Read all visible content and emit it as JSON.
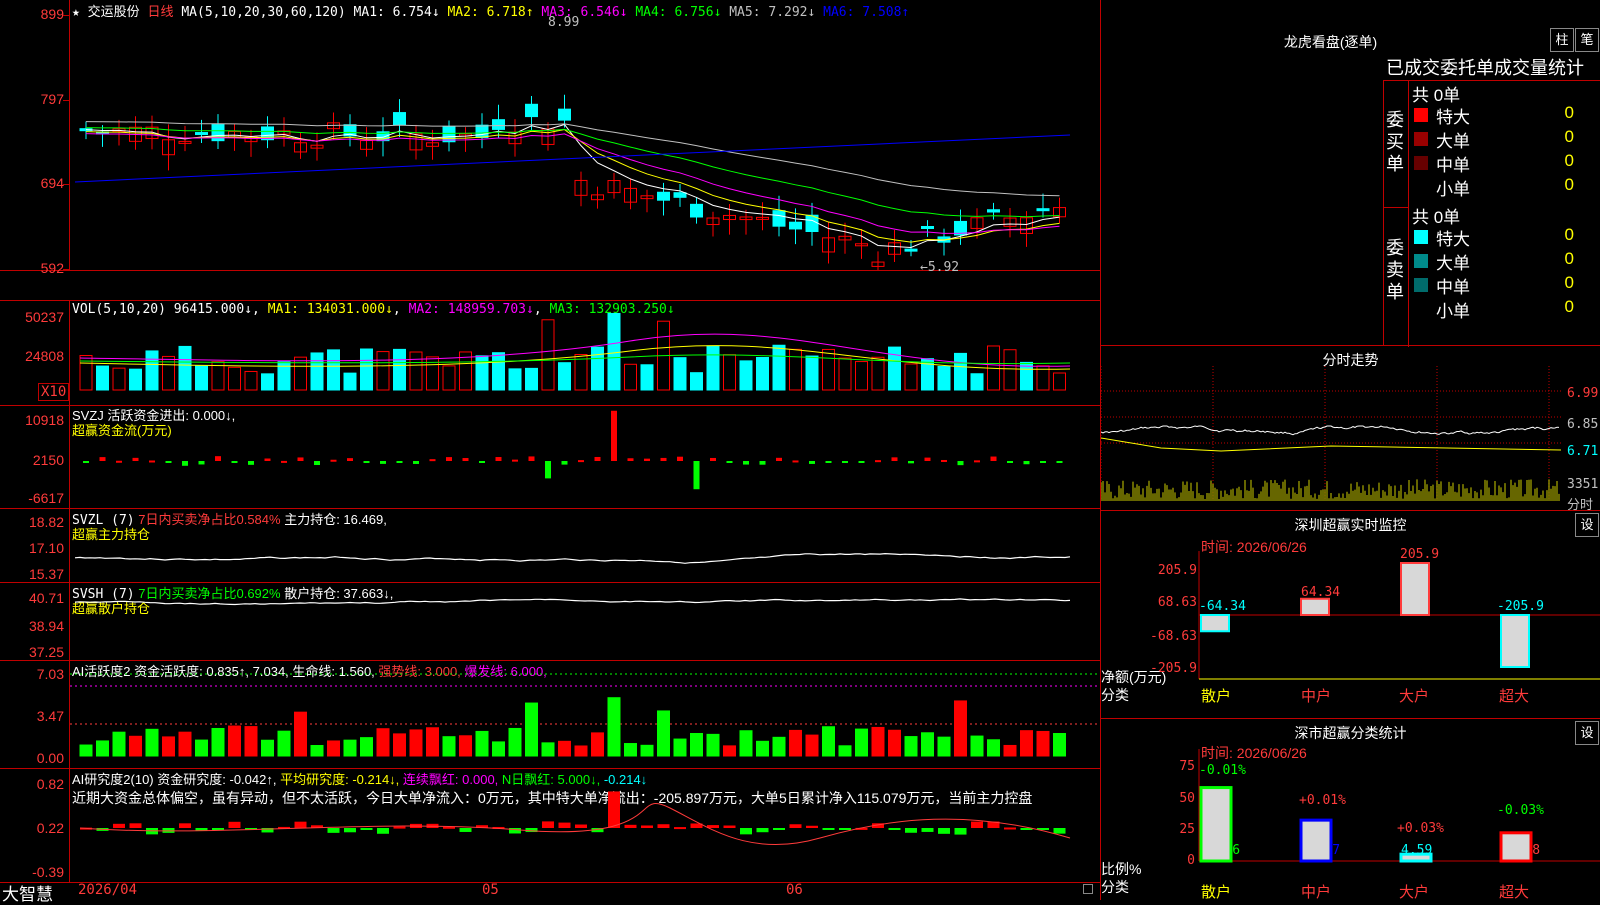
{
  "stock": {
    "name": "交运股份",
    "period": "日线",
    "ma_label": "MA(5,10,20,30,60,120)",
    "ma1": "MA1: 6.754↓",
    "ma2": "MA2: 6.718↑",
    "ma3": "MA3: 6.546↓",
    "ma4": "MA4: 6.756↓",
    "ma5": "MA5: 7.292↓",
    "ma6": "MA6: 7.508↑",
    "high_mark": "8.99",
    "low_mark": "←5.92",
    "price_axis": [
      "899",
      "797",
      "694",
      "592"
    ]
  },
  "vol": {
    "header": "VOL(5,10,20)",
    "v": "96415.000↓",
    "ma1": "MA1: 134031.000↓",
    "ma2": "MA2: 148959.703↓",
    "ma3": "MA3: 132903.250↓",
    "axis": [
      "50237",
      "24808"
    ],
    "unit": "X10"
  },
  "svzj": {
    "header": "SVZJ  活跃资金进出: 0.000↓,",
    "subtitle": "超赢资金流(万元)",
    "axis": [
      "10918",
      "2150",
      "-6617"
    ]
  },
  "svzl": {
    "name": "SVZL (7)",
    "ratio": "7日内买卖净占比0.584%",
    "hold": "主力持仓: 16.469,",
    "subtitle": "超赢主力持仓",
    "axis": [
      "18.82",
      "17.10",
      "15.37"
    ]
  },
  "svsh": {
    "name": "SVSH (7)",
    "ratio": "7日内买卖净占比0.692%",
    "hold": "散户持仓: 37.663↓,",
    "subtitle": "超赢散户持仓",
    "axis": [
      "40.71",
      "38.94",
      "37.25"
    ]
  },
  "ai1": {
    "name": "AI活跃度2",
    "a": "资金活跃度: 0.835↑,",
    "b": "7.034,",
    "c": "生命线: 1.560,",
    "d": "强势线: 3.000,",
    "e": "爆发线: 6.000,",
    "axis": [
      "7.03",
      "3.47",
      "0.00"
    ]
  },
  "ai2": {
    "name": "AI研究度2(10)",
    "a": "资金研究度: -0.042↑,",
    "b": "平均研究度: -0.214↓,",
    "c": "连续飘红: 0.000,",
    "d": "N日飘红: 5.000↓,",
    "e": "-0.214↓",
    "note": "近期大资金总体偏空，虽有异动，但不太活跃，今日大单净流入：0万元，其中特大单净流出：-205.897万元，大单5日累计净入115.079万元，当前主力控盘",
    "axis": [
      "0.82",
      "0.22",
      "-0.39"
    ]
  },
  "timeaxis": {
    "brand": "大智慧",
    "labels": [
      "2026/04",
      "05",
      "06"
    ]
  },
  "lhb": {
    "title": "龙虎看盘(逐单)",
    "btn1": "柱",
    "btn2": "笔",
    "stat_title": "已成交委托单成交量统计",
    "buy_label": "委买单",
    "sell_label": "委卖单",
    "buy_total": "共 0单",
    "sell_total": "共 0单",
    "buy_rows": [
      {
        "name": "特大",
        "v": "0",
        "p": "0%",
        "color": "#ff0000"
      },
      {
        "name": "大单",
        "v": "0",
        "p": "0%",
        "color": "#990000"
      },
      {
        "name": "中单",
        "v": "0",
        "p": "0%",
        "color": "#660000"
      },
      {
        "name": "小单",
        "v": "0",
        "p": "0%",
        "color": "#000000"
      }
    ],
    "sell_rows": [
      {
        "name": "特大",
        "v": "0",
        "p": "0%",
        "color": "#00ffff"
      },
      {
        "name": "大单",
        "v": "0",
        "p": "0%",
        "color": "#008b8b"
      },
      {
        "name": "中单",
        "v": "0",
        "p": "0%",
        "color": "#006b6b"
      },
      {
        "name": "小单",
        "v": "0",
        "p": "0%",
        "color": "#000000"
      }
    ]
  },
  "intraday": {
    "title": "分时走势",
    "axis": [
      "6.99",
      "6.85",
      "6.71"
    ],
    "vol_label": "3351",
    "unit": "分时"
  },
  "monitor": {
    "title": "深圳超赢实时监控",
    "btn": "设",
    "time": "时间: 2026/06/26",
    "axis": [
      "205.9",
      "68.63",
      "-68.63",
      "-205.9"
    ],
    "ylabel": "净额(万元)",
    "xlabel": "分类",
    "cats": [
      "散户",
      "中户",
      "大户",
      "超大"
    ],
    "labels": [
      "-64.34",
      "64.34",
      "205.9",
      "-205.9"
    ]
  },
  "classify": {
    "title": "深市超赢分类统计",
    "btn": "设",
    "time": "时间: 2026/06/26",
    "axis": [
      "75",
      "50",
      "25",
      "0"
    ],
    "ylabel": "比例%",
    "xlabel": "分类",
    "cats": [
      "散户",
      "中户",
      "大户",
      "超大"
    ],
    "changes": [
      "-0.01%",
      "+0.01%",
      "+0.03%",
      "-0.03%"
    ],
    "values": [
      "49.16",
      "27.37",
      "4.59",
      "18.88"
    ]
  },
  "colors": {
    "up": "#ff0000",
    "down": "#00ffff",
    "border": "#c00000",
    "yellow": "#ffff00"
  }
}
